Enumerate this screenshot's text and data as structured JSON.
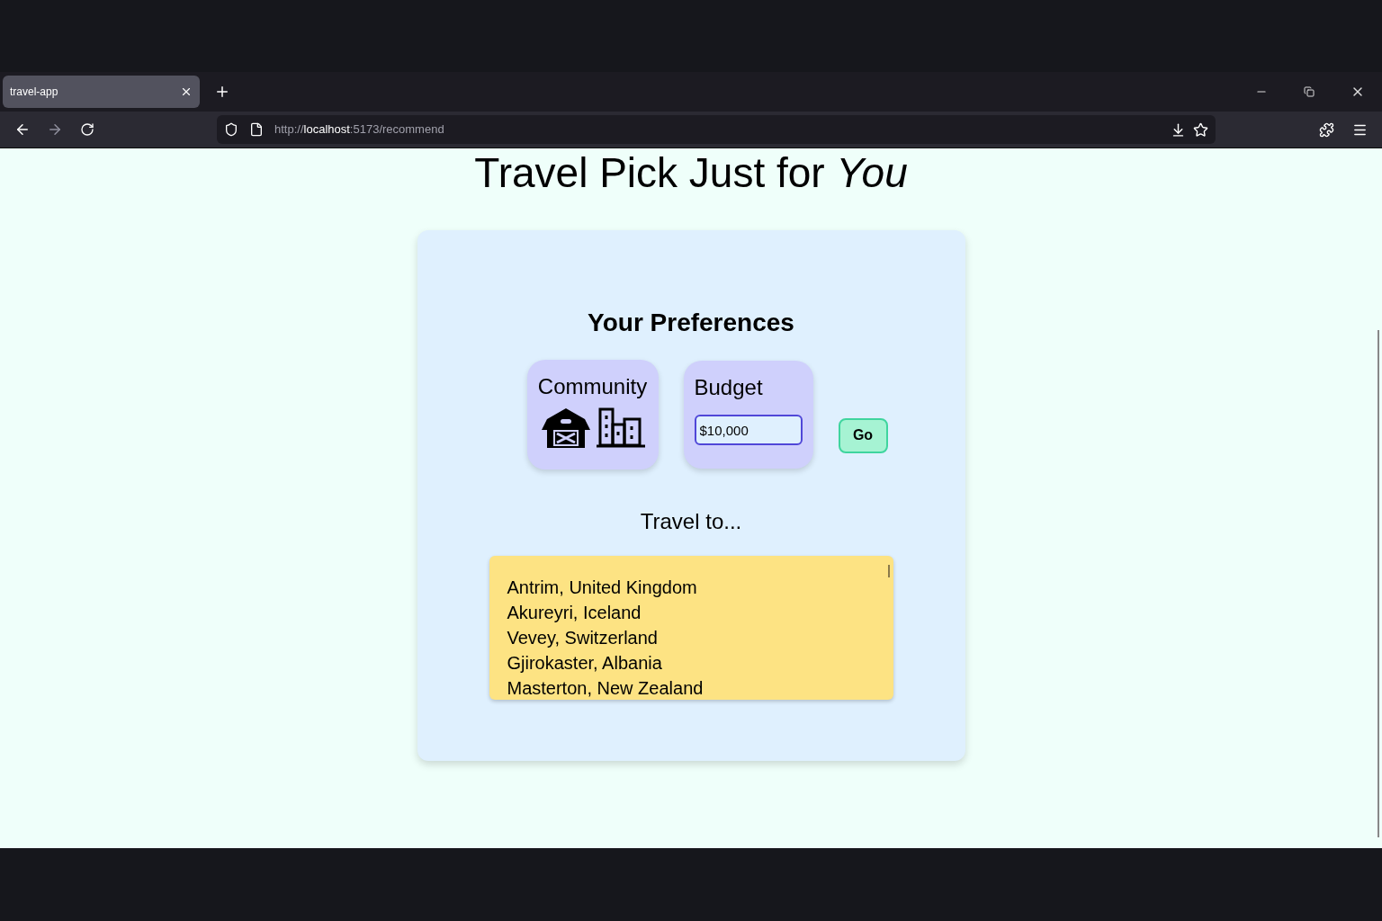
{
  "browser": {
    "tabs": [
      {
        "title": "travel-app",
        "selected": true
      }
    ],
    "url": "http://**localhost**:5173/recommend"
  },
  "page": {
    "title": "Travel Pick Just for *You*",
    "preferences": {
      "heading": "Your Preferences",
      "community": {
        "label": "Community"
      },
      "budget": {
        "label": "Budget",
        "value": "$10,000"
      },
      "go_button": "Go"
    },
    "results": {
      "heading": "Travel to...",
      "destinations": [
        "Antrim, United Kingdom",
        "Akureyri, Iceland",
        "Vevey, Switzerland",
        "Gjirokaster, Albania",
        "Masterton, New Zealand"
      ]
    }
  }
}
